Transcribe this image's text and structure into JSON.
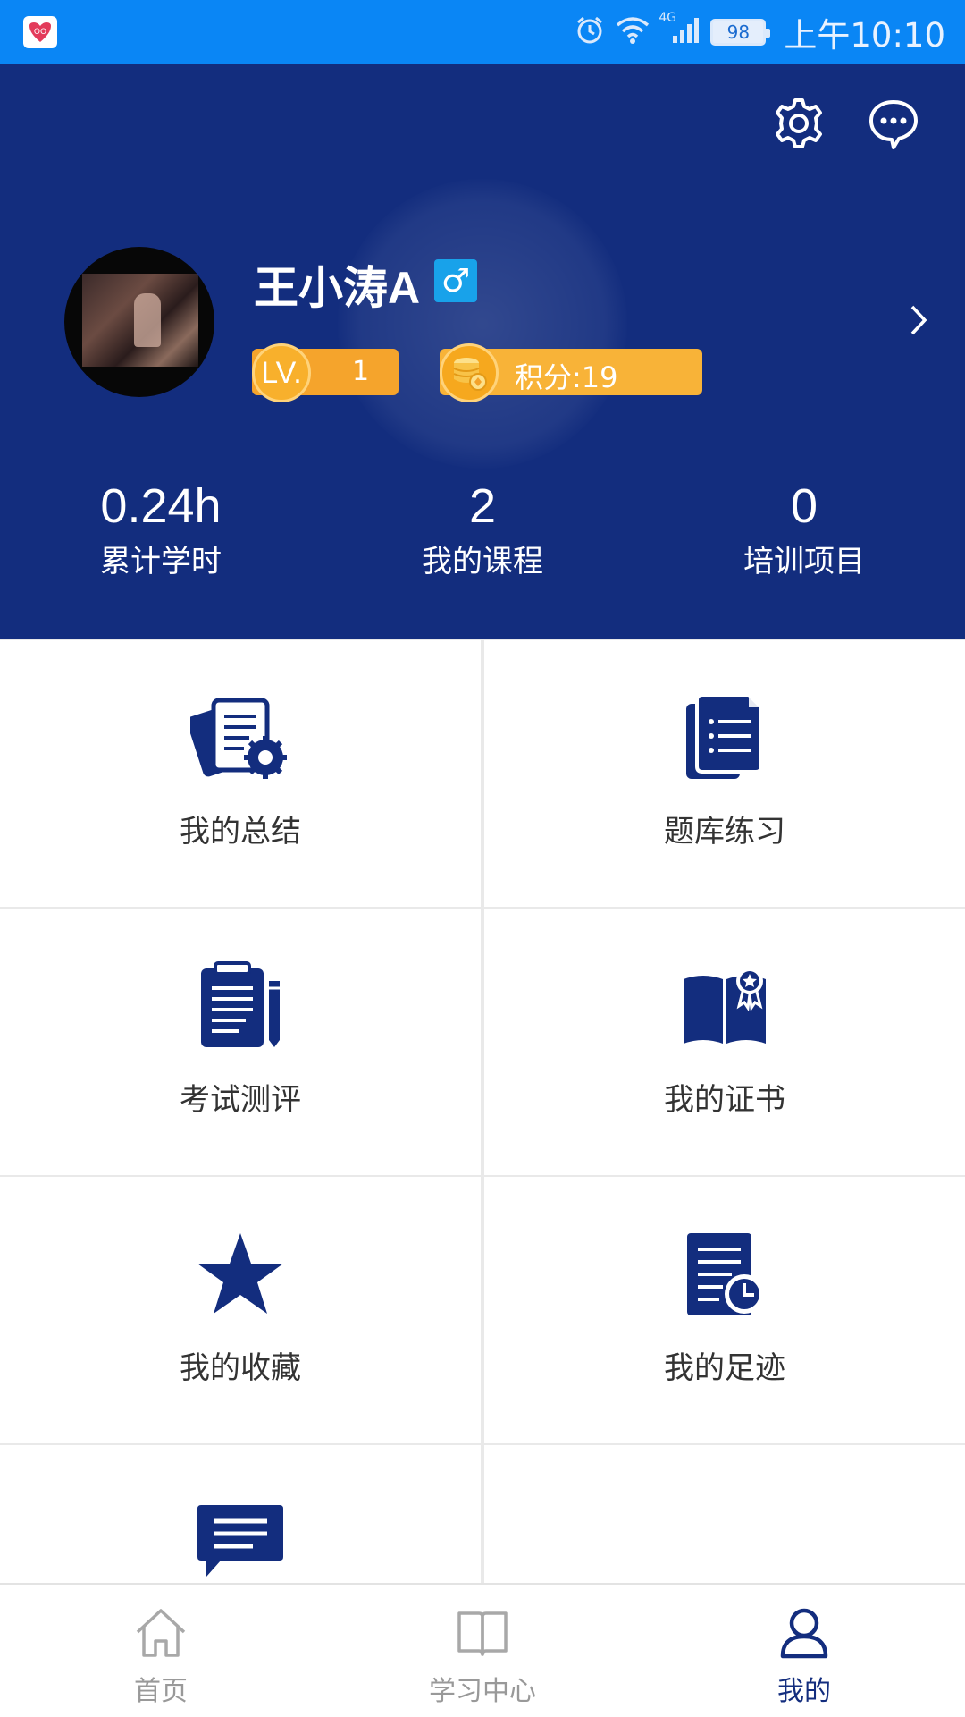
{
  "status_bar": {
    "network": "4G",
    "battery": "98",
    "time": "上午10:10"
  },
  "header": {
    "user_name": "王小涛A",
    "gender_symbol": "♂",
    "level_badge": "LV.",
    "level_value": "1",
    "points_label": "积分:19",
    "stats": [
      {
        "value": "0.24h",
        "label": "累计学时"
      },
      {
        "value": "2",
        "label": "我的课程"
      },
      {
        "value": "0",
        "label": "培训项目"
      }
    ]
  },
  "menu": [
    {
      "label": "我的总结",
      "icon": "summary-icon"
    },
    {
      "label": "题库练习",
      "icon": "question-bank-icon"
    },
    {
      "label": "考试测评",
      "icon": "exam-clipboard-icon"
    },
    {
      "label": "我的证书",
      "icon": "certificate-book-icon"
    },
    {
      "label": "我的收藏",
      "icon": "star-icon"
    },
    {
      "label": "我的足迹",
      "icon": "history-document-icon"
    },
    {
      "label": "",
      "icon": "chat-bubble-icon"
    }
  ],
  "bottom_nav": [
    {
      "label": "首页",
      "icon": "home-icon",
      "active": false
    },
    {
      "label": "学习中心",
      "icon": "book-icon",
      "active": false
    },
    {
      "label": "我的",
      "icon": "person-icon",
      "active": true
    }
  ],
  "colors": {
    "status_bar": "#0a86f5",
    "header_bg": "#132d7e",
    "icon_primary": "#132d7e",
    "level_orange": "#f5a42c",
    "points_orange": "#f8b338",
    "gender_blue": "#18a2ea"
  }
}
